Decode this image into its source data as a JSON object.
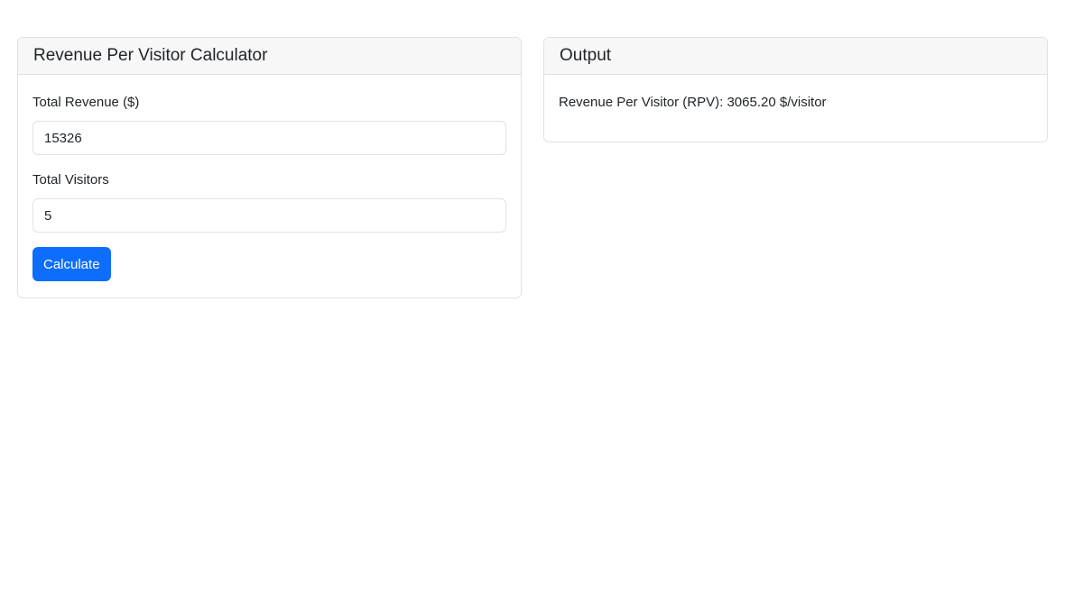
{
  "calculator": {
    "title": "Revenue Per Visitor Calculator",
    "revenue_label": "Total Revenue ($)",
    "revenue_value": "15326",
    "visitors_label": "Total Visitors",
    "visitors_value": "5",
    "calculate_label": "Calculate"
  },
  "output": {
    "title": "Output",
    "result_text": "Revenue Per Visitor (RPV): 3065.20 $/visitor"
  },
  "colors": {
    "primary": "#0d6efd",
    "header_bg": "#f7f7f7",
    "border": "#dee2e6"
  }
}
